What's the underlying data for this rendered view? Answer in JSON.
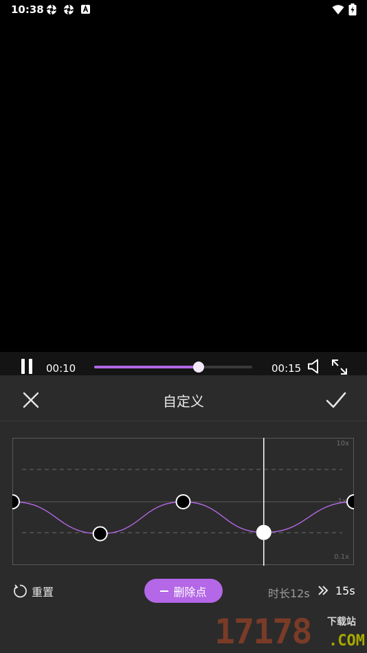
{
  "status_bar": {
    "time": "10:38",
    "icons": [
      "settings-gear-icon",
      "settings-gear-icon",
      "a-badge-icon",
      "wifi-icon",
      "battery-charging-icon"
    ]
  },
  "player": {
    "current_time": "00:10",
    "total_time": "00:15",
    "progress_fraction": 0.66,
    "accent_color": "#b467e6"
  },
  "panel": {
    "title": "自定义",
    "close_icon": "close-icon",
    "confirm_icon": "check-icon"
  },
  "curve": {
    "labels": {
      "top": "10x",
      "mid": "1x",
      "bottom": "0.1x"
    },
    "points": [
      {
        "t": 0.0,
        "speed_level": 0.5,
        "selected": false
      },
      {
        "t": 0.257,
        "speed_level": 0.25,
        "selected": false
      },
      {
        "t": 0.5,
        "speed_level": 0.5,
        "selected": false
      },
      {
        "t": 0.736,
        "speed_level": 0.26,
        "selected": true
      },
      {
        "t": 1.0,
        "speed_level": 0.5,
        "selected": false
      }
    ],
    "playhead_fraction": 0.736,
    "curve_color": "#b467e6"
  },
  "footer": {
    "reset_label": "重置",
    "delete_label": "删除点",
    "duration_original": "时长12s",
    "duration_new": "15s"
  },
  "watermark": {
    "digits": "17178",
    "tag": "下载站",
    "domain": ".COM"
  }
}
